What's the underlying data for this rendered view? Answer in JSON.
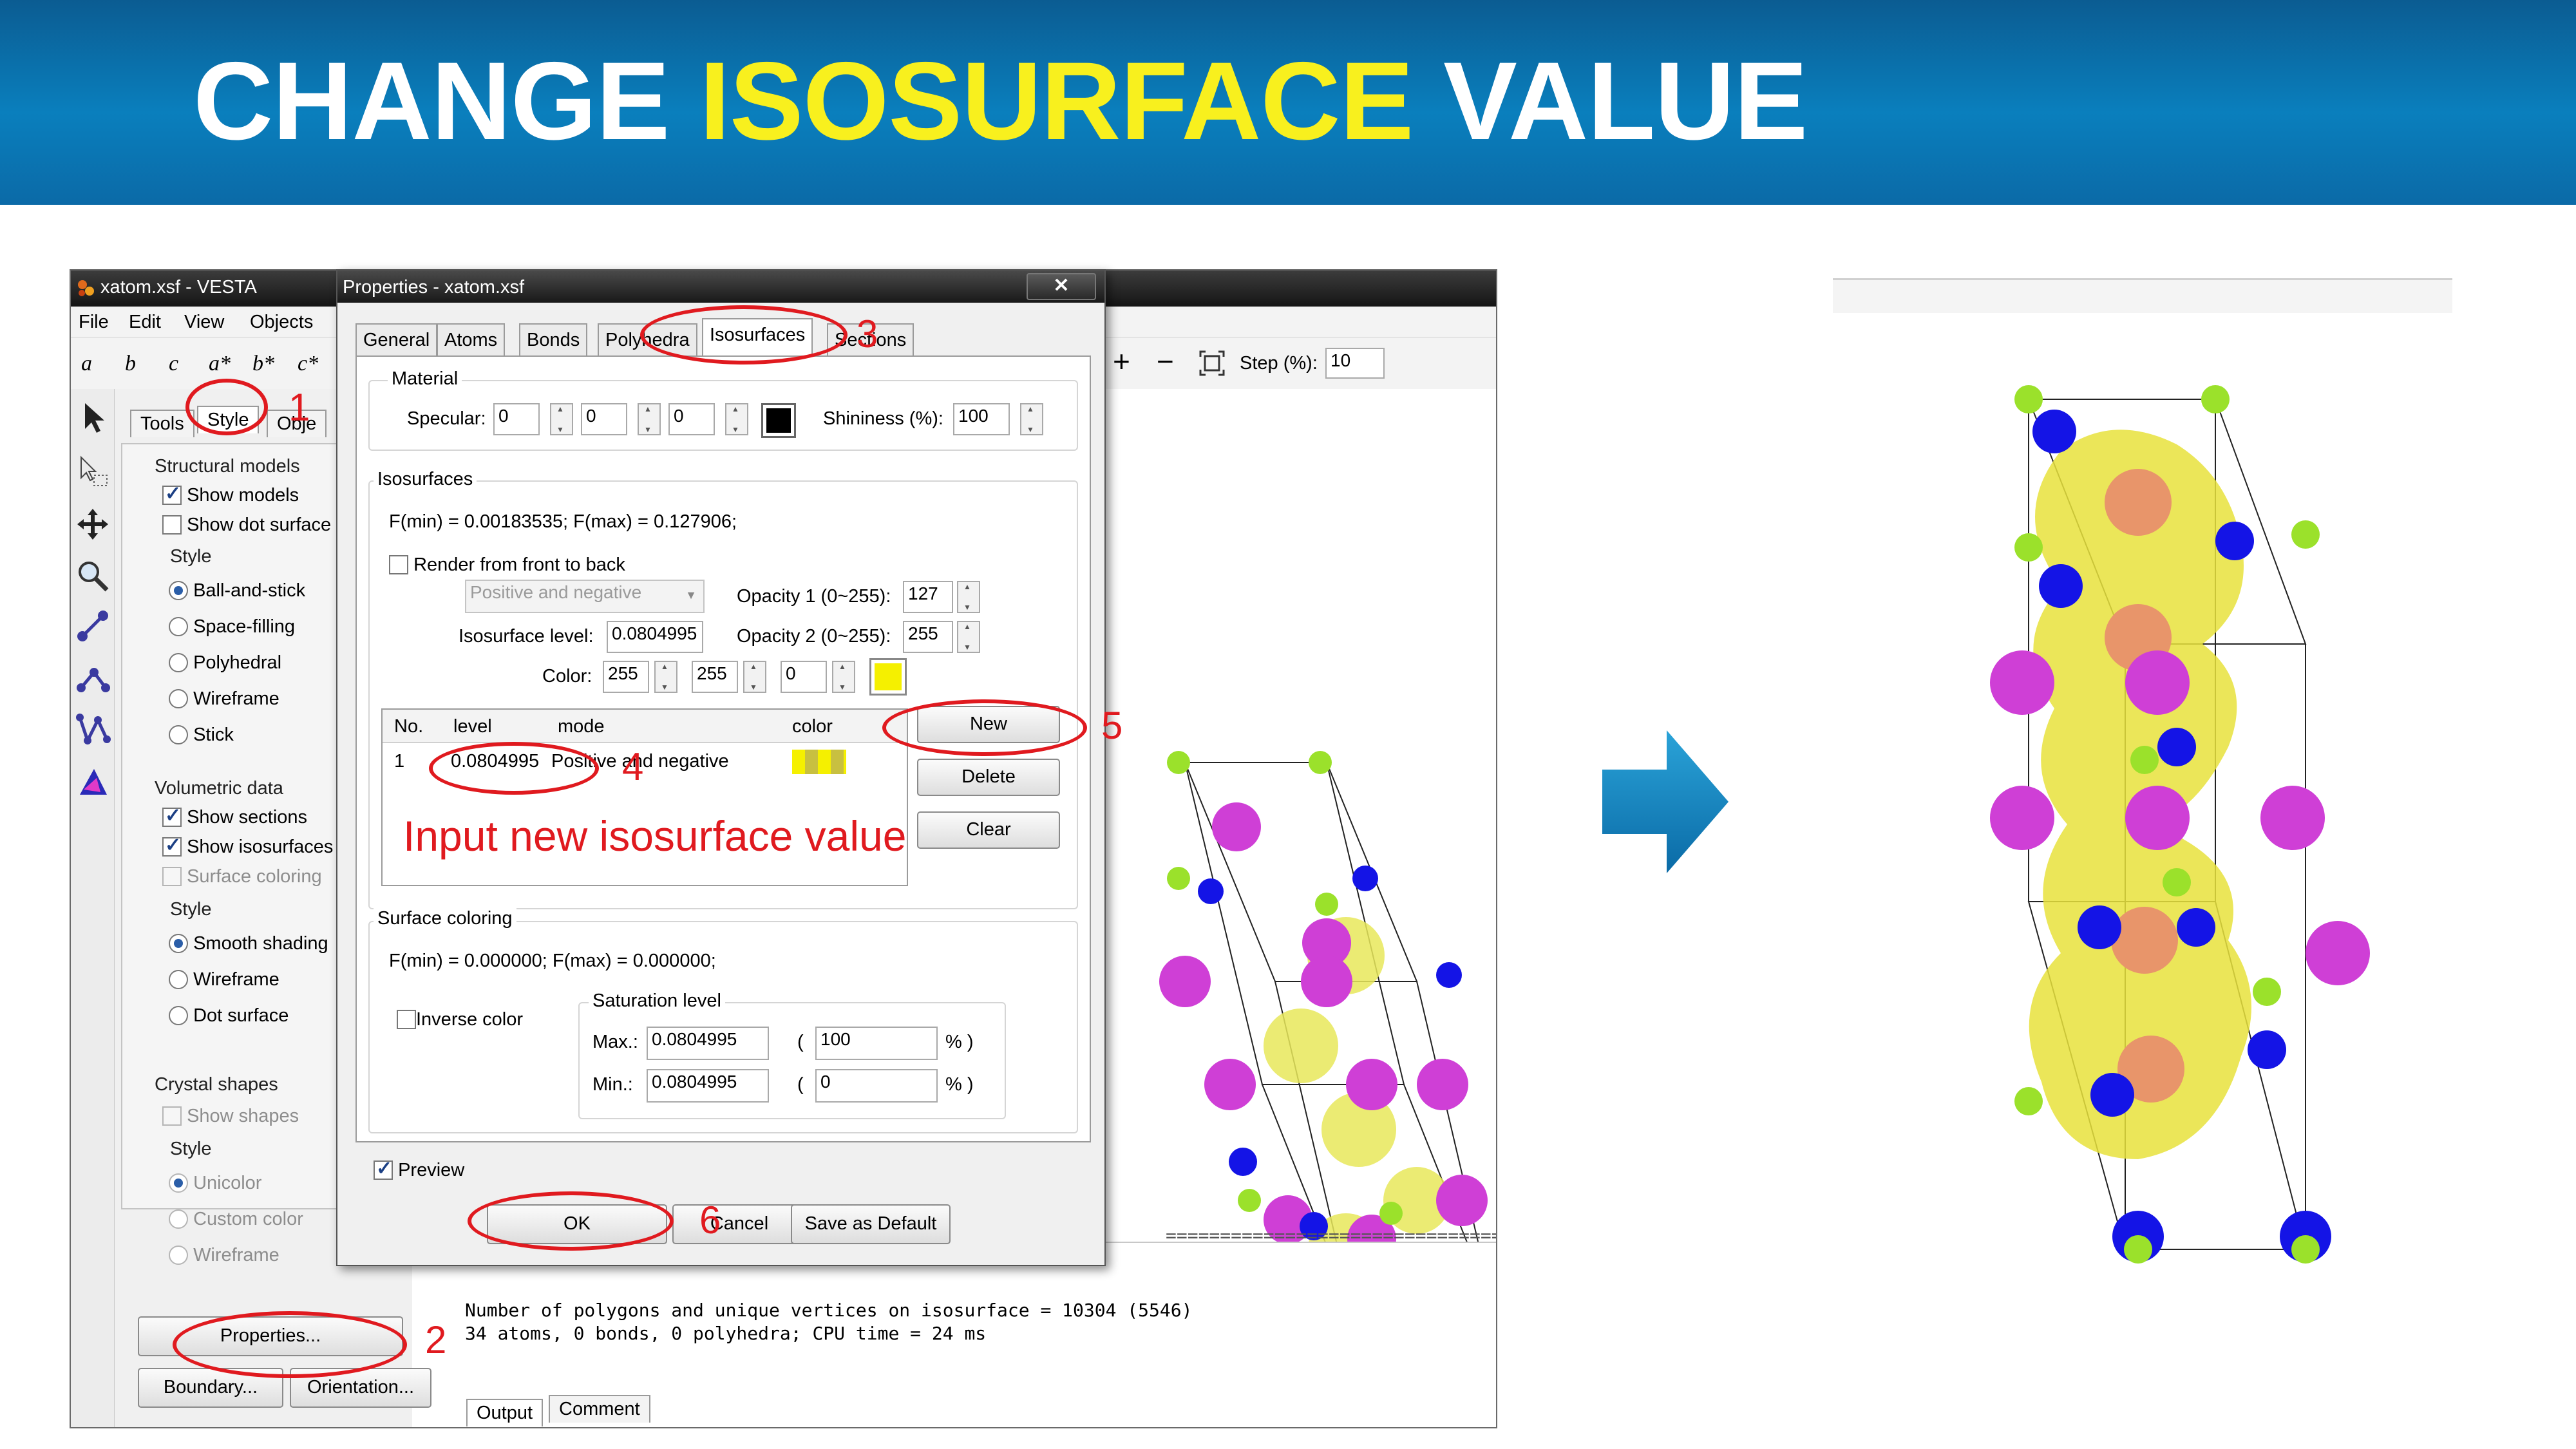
{
  "slide": {
    "title_part1": "CHANGE ",
    "title_highlight": "ISOSURFACE",
    "title_part2": " VALUE",
    "header_color": "#0a7fbd",
    "highlight_color": "#f8f01e",
    "annotation_color": "#e01a1f",
    "annotation_text": "Input new isosurface value",
    "step_numbers": [
      "1",
      "2",
      "3",
      "4",
      "5",
      "6"
    ],
    "arrow_icon": "right-arrow-icon"
  },
  "vesta": {
    "title": "xatom.xsf - VESTA",
    "menu": [
      "File",
      "Edit",
      "View",
      "Objects"
    ],
    "toolbar_axes": [
      "a",
      "b",
      "c",
      "a*",
      "b*",
      "c*"
    ],
    "plus_label": "+",
    "minus_label": "−",
    "step_label": "Step (%):",
    "step_value": "10",
    "side_tabs": [
      "Tools",
      "Style",
      "Obje"
    ],
    "structural_models": {
      "title": "Structural models",
      "show_models": "Show models",
      "show_dot_surface": "Show dot surface",
      "style_title": "Style",
      "styles": [
        "Ball-and-stick",
        "Space-filling",
        "Polyhedral",
        "Wireframe",
        "Stick"
      ]
    },
    "volumetric": {
      "title": "Volumetric data",
      "show_sections": "Show sections",
      "show_isosurfaces": "Show isosurfaces",
      "surface_coloring": "Surface coloring",
      "style_title": "Style",
      "styles": [
        "Smooth shading",
        "Wireframe",
        "Dot surface"
      ]
    },
    "crystal": {
      "title": "Crystal shapes",
      "show_shapes": "Show shapes",
      "style_title": "Style",
      "styles": [
        "Unicolor",
        "Custom color",
        "Wireframe"
      ]
    },
    "properties_button": "Properties...",
    "boundary_button": "Boundary...",
    "orientation_button": "Orientation...",
    "output_lines": [
      "Number of polygons and unique vertices on isosurface = 10304 (5546)",
      "34 atoms, 0 bonds, 0 polyhedra; CPU time = 24 ms"
    ],
    "output_tabs": [
      "Output",
      "Comment"
    ],
    "separator_line": "================================"
  },
  "props": {
    "title": "Properties - xatom.xsf",
    "close_label": "✕",
    "tabs": [
      "General",
      "Atoms",
      "Bonds",
      "Polyhedra",
      "Isosurfaces",
      "Sections"
    ],
    "material": {
      "title": "Material",
      "specular_label": "Specular:",
      "specular_values": [
        "0",
        "0",
        "0"
      ],
      "specular_color": "#000000",
      "shininess_label": "Shininess (%):",
      "shininess_value": "100"
    },
    "isosurfaces": {
      "title": "Isosurfaces",
      "fmin_fmax": "F(min) = 0.00183535;   F(max) = 0.127906;",
      "render_front": "Render from front to back",
      "mode_value": "Positive and negative",
      "opacity1_label": "Opacity 1 (0~255):",
      "opacity1_value": "127",
      "opacity2_label": "Opacity 2 (0~255):",
      "opacity2_value": "255",
      "level_label": "Isosurface level:",
      "level_value": "0.0804995",
      "color_label": "Color:",
      "color_values": [
        "255",
        "255",
        "0"
      ],
      "color_swatch": "#f5f000",
      "table_headers": [
        "No.",
        "level",
        "mode",
        "color"
      ],
      "table_rows": [
        {
          "no": "1",
          "level": "0.0804995",
          "mode": "Positive and negative"
        }
      ],
      "new_button": "New",
      "delete_button": "Delete",
      "clear_button": "Clear"
    },
    "surface_coloring": {
      "title": "Surface coloring",
      "fmin_fmax": "F(min) = 0.000000;   F(max) = 0.000000;",
      "inverse_color": "Inverse color",
      "saturation_title": "Saturation level",
      "max_label": "Max.:",
      "max_value": "0.0804995",
      "max_pct": "100",
      "min_label": "Min.:",
      "min_value": "0.0804995",
      "min_pct": "0",
      "open_paren": "(",
      "pct_close": "% )"
    },
    "preview_label": "Preview",
    "ok_button": "OK",
    "cancel_button": "Cancel",
    "save_default_button": "Save as Default"
  }
}
